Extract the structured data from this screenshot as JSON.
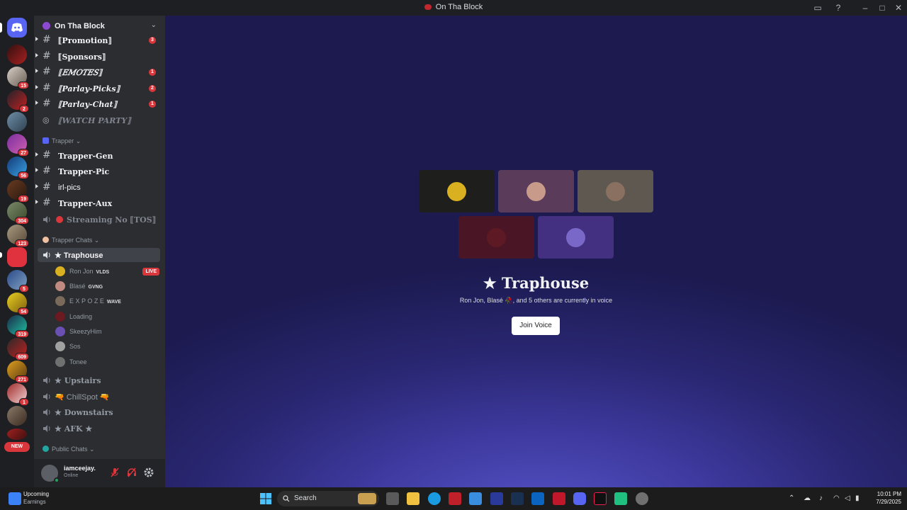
{
  "window": {
    "title": "On Tha Block"
  },
  "server_rail": {
    "badges": [
      "15",
      "2",
      "27",
      "56",
      "19",
      "304",
      "123",
      "5",
      "54",
      "319",
      "609",
      "271",
      "1"
    ],
    "new_label": "NEW"
  },
  "server": {
    "name": "On Tha Block"
  },
  "channels_top": [
    {
      "name": "⟦Promotion⟧",
      "unread": "3"
    },
    {
      "name": "⟦Sponsors⟧",
      "unread": ""
    },
    {
      "name": "⟦𝐸𝑀𝑂𝑇𝐸𝑆⟧",
      "unread": "1"
    },
    {
      "name": "⟦Parlay-Picks⟧",
      "unread": "2"
    },
    {
      "name": "⟦Parlay-Chat⟧",
      "unread": "1"
    },
    {
      "name": "⟦WATCH PARTY⟧",
      "unread": ""
    }
  ],
  "category_trapper": {
    "label": "Trapper"
  },
  "channels_trapper": [
    {
      "name": "Trapper-Gen"
    },
    {
      "name": "Trapper-Pic"
    },
    {
      "name": "irl-pics"
    },
    {
      "name": "Trapper-Aux"
    },
    {
      "name": "Streaming No ⟦TOS⟧"
    }
  ],
  "category_chats": {
    "label": "Trapper Chats"
  },
  "active_voice": {
    "name": "★ Traphouse"
  },
  "voice_users": [
    {
      "name": "Ron Jon",
      "tag": "VLDS",
      "live": "LIVE"
    },
    {
      "name": "Blasé",
      "tag": "GVNG",
      "live": ""
    },
    {
      "name": "E X P O Z E",
      "tag": "WAVE",
      "live": ""
    },
    {
      "name": "Loading",
      "tag": "",
      "live": ""
    },
    {
      "name": "SkeezyHim",
      "tag": "",
      "live": ""
    },
    {
      "name": "Sos",
      "tag": "",
      "live": ""
    },
    {
      "name": "Tonee",
      "tag": "",
      "live": ""
    }
  ],
  "voice_channels": [
    {
      "name": "★ Upstairs"
    },
    {
      "name": "🔫 ChillSpot 🔫"
    },
    {
      "name": "★ Downstairs"
    },
    {
      "name": "★ AFK ★"
    }
  ],
  "category_public": {
    "label": "Public Chats"
  },
  "user": {
    "name": "iamceejay.",
    "status": "Online"
  },
  "main": {
    "title": "★ Traphouse",
    "subtitle": "Ron Jon, Blasé 🥀, and 5 others are currently in voice",
    "join_label": "Join Voice"
  },
  "taskbar": {
    "weather_title": "Upcoming",
    "weather_sub": "Earnings",
    "search_label": "Search",
    "time": "10:01 PM",
    "date": "7/29/2025"
  },
  "colors": {
    "accent": "#5865f2",
    "danger": "#da373c",
    "online": "#23a55a"
  }
}
